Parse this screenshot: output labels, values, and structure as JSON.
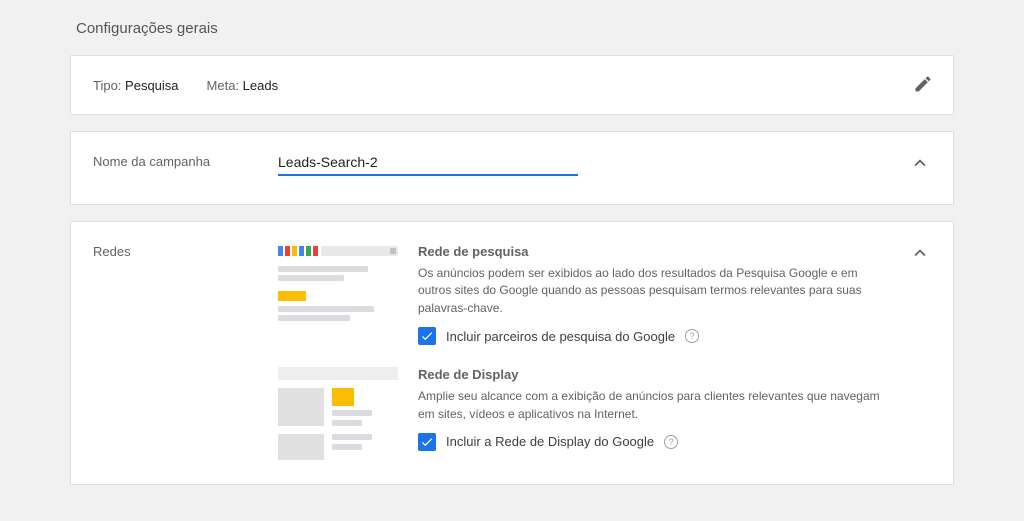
{
  "page": {
    "title": "Configurações gerais"
  },
  "summary": {
    "type_label": "Tipo:",
    "type_value": "Pesquisa",
    "goal_label": "Meta:",
    "goal_value": "Leads"
  },
  "campaign": {
    "section_label": "Nome da campanha",
    "name_value": "Leads-Search-2"
  },
  "networks": {
    "section_label": "Redes",
    "search": {
      "heading": "Rede de pesquisa",
      "description": "Os anúncios podem ser exibidos ao lado dos resultados da Pesquisa Google e em outros sites do Google quando as pessoas pesquisam termos relevantes para suas palavras-chave.",
      "checkbox_label": "Incluir parceiros de pesquisa do Google",
      "checked": true
    },
    "display": {
      "heading": "Rede de Display",
      "description": "Amplie seu alcance com a exibição de anúncios para clientes relevantes que navegam em sites, vídeos e aplicativos na Internet.",
      "checkbox_label": "Incluir a Rede de Display do Google",
      "checked": true
    }
  }
}
